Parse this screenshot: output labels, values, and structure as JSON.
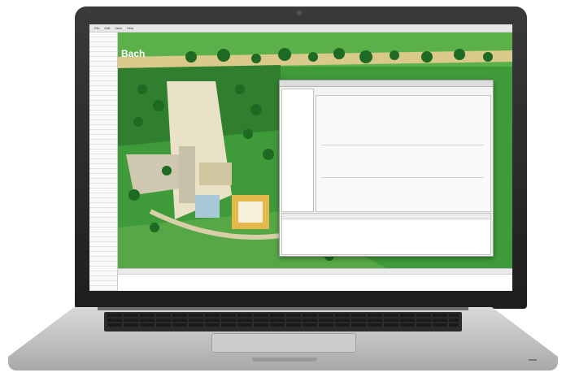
{
  "window": {
    "title": "",
    "menu": [
      "File",
      "Edit",
      "View",
      "Help"
    ]
  },
  "left_panel": {
    "rows": []
  },
  "map": {
    "label": "Bach"
  },
  "dialog": {
    "title": "",
    "nav_items": [],
    "tabs": [],
    "fields": [],
    "lower_table": {
      "headers": [],
      "rows": []
    }
  },
  "bottom_table": {
    "headers": [],
    "rows": []
  },
  "colors": {
    "map_green": "#3f9a3a",
    "selection_blue": "#3a78c8",
    "dialog_bg": "#f2f2f2"
  }
}
